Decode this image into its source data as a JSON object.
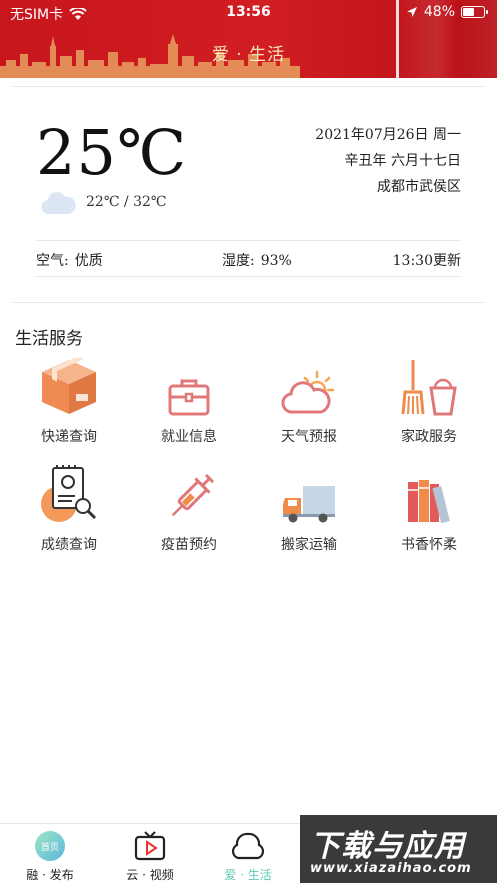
{
  "status_bar": {
    "carrier": "无SIM卡",
    "time": "13:56",
    "battery": "48%",
    "battery_level": 0.48,
    "icons": [
      "wifi-icon",
      "location-arrow-icon",
      "battery-icon"
    ]
  },
  "header": {
    "title": "爱 · 生活"
  },
  "weather": {
    "temperature": "25℃",
    "date": "2021年07月26日 周一",
    "lunar_date": "辛丑年 六月十七日",
    "location": "成都市武侯区",
    "range": "22℃ / 32℃",
    "air_label": "空气:",
    "air_value": "优质",
    "humidity_label": "湿度:",
    "humidity_value": "93%",
    "updated": "13:30更新",
    "condition_icon": "cloud-icon"
  },
  "services": {
    "title": "生活服务",
    "items": [
      {
        "label": "快递查询",
        "icon": "package-icon"
      },
      {
        "label": "就业信息",
        "icon": "briefcase-icon"
      },
      {
        "label": "天气预报",
        "icon": "weather-icon"
      },
      {
        "label": "家政服务",
        "icon": "broom-bucket-icon"
      },
      {
        "label": "成绩查询",
        "icon": "certificate-icon"
      },
      {
        "label": "疫苗预约",
        "icon": "syringe-icon"
      },
      {
        "label": "搬家运输",
        "icon": "truck-icon"
      },
      {
        "label": "书香怀柔",
        "icon": "books-icon"
      }
    ]
  },
  "tabbar": {
    "tabs": [
      {
        "label": "融 · 发布",
        "icon": "home-icon",
        "badge": "首页"
      },
      {
        "label": "云 · 视频",
        "icon": "tv-play-icon"
      },
      {
        "label": "爱 · 生活",
        "icon": "life-icon",
        "active": true
      }
    ]
  },
  "watermark": {
    "line1": "下载与应用",
    "line2": "www.xiazaihao.com"
  },
  "colors": {
    "header_red": "#c8161d",
    "active_tab": "#5ec9b8",
    "icon_red": "#e0787a",
    "icon_orange": "#f08c4a"
  }
}
